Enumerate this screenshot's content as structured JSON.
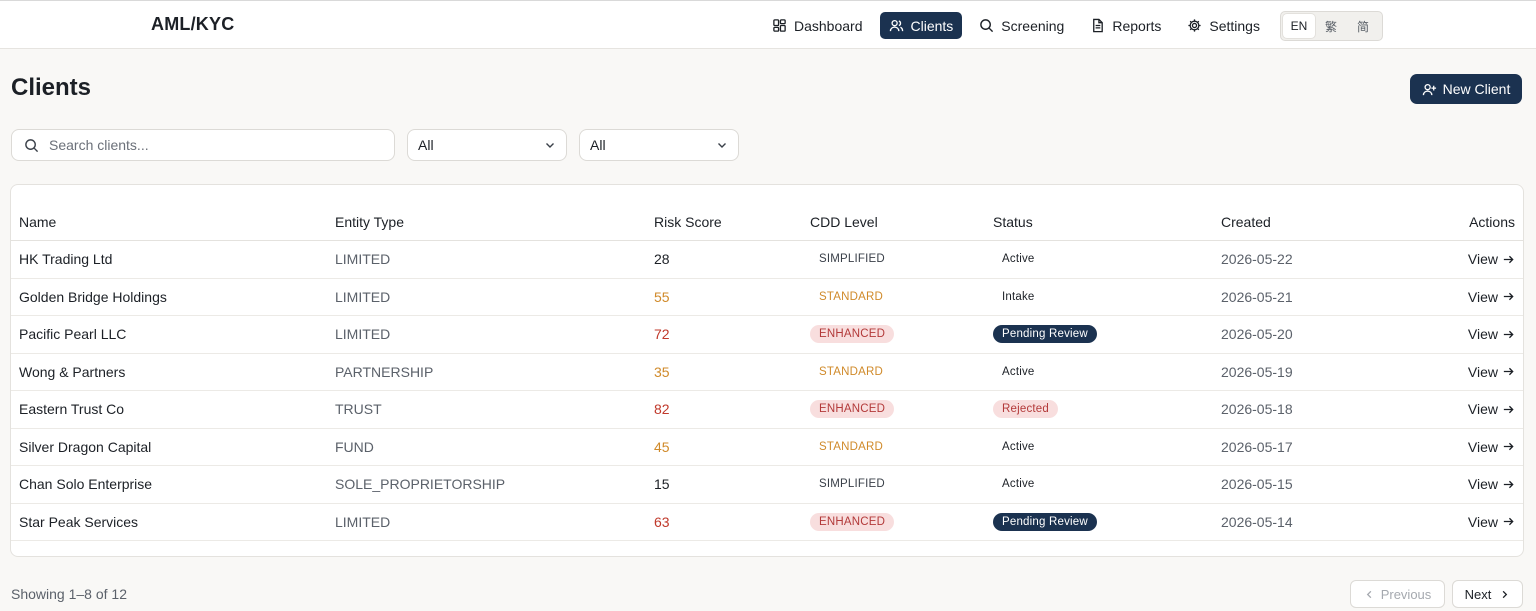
{
  "app": {
    "brand": "AML/KYC"
  },
  "nav": {
    "items": [
      {
        "label": "Dashboard",
        "icon": "dashboard-icon",
        "active": false
      },
      {
        "label": "Clients",
        "icon": "users-icon",
        "active": true
      },
      {
        "label": "Screening",
        "icon": "search-icon",
        "active": false
      },
      {
        "label": "Reports",
        "icon": "document-icon",
        "active": false
      },
      {
        "label": "Settings",
        "icon": "gear-icon",
        "active": false
      }
    ]
  },
  "lang": {
    "options": [
      "EN",
      "繁",
      "简"
    ],
    "selected": "EN"
  },
  "page": {
    "title": "Clients",
    "new_client_label": "New Client"
  },
  "filters": {
    "search_placeholder": "Search clients...",
    "search_value": "",
    "filter1_value": "All",
    "filter2_value": "All"
  },
  "table": {
    "headers": [
      "Name",
      "Entity Type",
      "Risk Score",
      "CDD Level",
      "Status",
      "Created",
      "Actions"
    ],
    "rows": [
      {
        "name": "HK Trading Ltd",
        "type": "LIMITED",
        "risk": "28",
        "risk_level": "low",
        "cdd": "SIMPLIFIED",
        "status": "Active",
        "created": "2026-05-22",
        "action": "View"
      },
      {
        "name": "Golden Bridge Holdings",
        "type": "LIMITED",
        "risk": "55",
        "risk_level": "mid",
        "cdd": "STANDARD",
        "status": "Intake",
        "created": "2026-05-21",
        "action": "View"
      },
      {
        "name": "Pacific Pearl LLC",
        "type": "LIMITED",
        "risk": "72",
        "risk_level": "high",
        "cdd": "ENHANCED",
        "status": "Pending Review",
        "created": "2026-05-20",
        "action": "View"
      },
      {
        "name": "Wong & Partners",
        "type": "PARTNERSHIP",
        "risk": "35",
        "risk_level": "mid",
        "cdd": "STANDARD",
        "status": "Active",
        "created": "2026-05-19",
        "action": "View"
      },
      {
        "name": "Eastern Trust Co",
        "type": "TRUST",
        "risk": "82",
        "risk_level": "high",
        "cdd": "ENHANCED",
        "status": "Rejected",
        "created": "2026-05-18",
        "action": "View"
      },
      {
        "name": "Silver Dragon Capital",
        "type": "FUND",
        "risk": "45",
        "risk_level": "mid",
        "cdd": "STANDARD",
        "status": "Active",
        "created": "2026-05-17",
        "action": "View"
      },
      {
        "name": "Chan Solo Enterprise",
        "type": "SOLE_PROPRIETORSHIP",
        "risk": "15",
        "risk_level": "low",
        "cdd": "SIMPLIFIED",
        "status": "Active",
        "created": "2026-05-15",
        "action": "View"
      },
      {
        "name": "Star Peak Services",
        "type": "LIMITED",
        "risk": "63",
        "risk_level": "high",
        "cdd": "ENHANCED",
        "status": "Pending Review",
        "created": "2026-05-14",
        "action": "View"
      }
    ]
  },
  "pagination": {
    "summary": "Showing 1–8 of 12",
    "prev_label": "Previous",
    "next_label": "Next"
  },
  "colors": {
    "primary": "#1b3250",
    "risk_mid": "#d08a2a",
    "risk_high": "#c0392b",
    "badge_red_bg": "#f8dede"
  }
}
